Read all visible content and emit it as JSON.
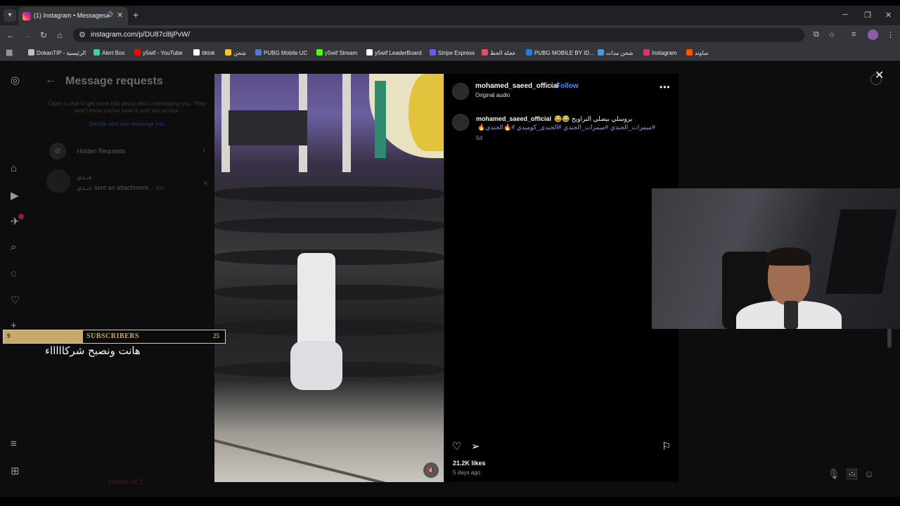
{
  "browser": {
    "tab_title": "(1) Instagram • Messages",
    "tab_speaker": "🔊",
    "tab_close": "✕",
    "new_tab": "+",
    "window_controls": {
      "minimize": "─",
      "restore": "❐",
      "close": "✕"
    },
    "url": "instagram.com/p/DU87cl8jPvW/",
    "bookmarks": [
      {
        "label": "DokanTIP - الرئيسية",
        "color": "#c0c0c0"
      },
      {
        "label": "Alert Box",
        "color": "#3ad2a5"
      },
      {
        "label": "y5wif - YouTube",
        "color": "#ff0000"
      },
      {
        "label": "tiktok",
        "color": "#ffffff"
      },
      {
        "label": "شحن",
        "color": "#f4c430"
      },
      {
        "label": "PUBG Mobile UC",
        "color": "#4a7bd6"
      },
      {
        "label": "y5wif Stream",
        "color": "#53fc18"
      },
      {
        "label": "y5wif LeaderBoard",
        "color": "#ffffff"
      },
      {
        "label": "Stripe Express",
        "color": "#635bff"
      },
      {
        "label": "عجلة الحظ",
        "color": "#e84a5f"
      },
      {
        "label": "PUBG MOBILE BY ID...",
        "color": "#2d7ad6"
      },
      {
        "label": "شحن مدات",
        "color": "#4a9ad6"
      },
      {
        "label": "Instagram",
        "color": "#e1306c"
      },
      {
        "label": "ساوند",
        "color": "#ff5500"
      }
    ]
  },
  "requests_panel": {
    "title": "Message requests",
    "subtitle": "Open a chat to get more info about who's messaging you. They won't know you've seen it until you accept.",
    "decide_link": "Decide who can message you",
    "hidden_requests": "Hidden Requests",
    "conversation": {
      "name": "عــدي",
      "message": "عــدي sent an attachment.",
      "time": "· 4m"
    },
    "delete_all": "Delete all 1",
    "notification_count": "1"
  },
  "post": {
    "username": "mohamed_saeed_official",
    "dot": "•",
    "follow": "Follow",
    "audio": "Original audio",
    "more": "•••",
    "caption": "بروسلي بيصلي التراويح 😂😂",
    "hashtags": "#ميمزات_الجندي #ميمزات_الجندي #الجندى_كوميدي #🔥الجندي🔥",
    "age": "5d",
    "likes": "21.2K likes",
    "posted": "5 days ago"
  },
  "overlay": {
    "sub_current": "9",
    "sub_label": "SUBSCRIBERS",
    "sub_goal": "25",
    "sub_progress": 0.36,
    "arabic_text": "هانت ونصبح شركاااااء"
  },
  "colors": {
    "accent": "#4f8bff",
    "sub_gold": "#c8a96a"
  }
}
